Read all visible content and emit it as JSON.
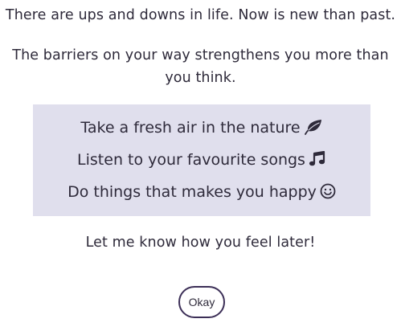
{
  "message": {
    "intro": "There are ups and downs in life. Now is new than past.",
    "barriers": "The barriers on your way strengthens you more than you think."
  },
  "tips": [
    {
      "text": "Take a fresh air in the nature",
      "icon": "leaf-icon"
    },
    {
      "text": "Listen to your favourite songs",
      "icon": "music-note-icon"
    },
    {
      "text": "Do things that makes you happy",
      "icon": "smiley-icon"
    }
  ],
  "closing": "Let me know how you feel later!",
  "actions": {
    "okay_label": "Okay"
  },
  "colors": {
    "text": "#2e2a3a",
    "tips_background": "#e0dfed",
    "button_border": "#3c2f57"
  }
}
